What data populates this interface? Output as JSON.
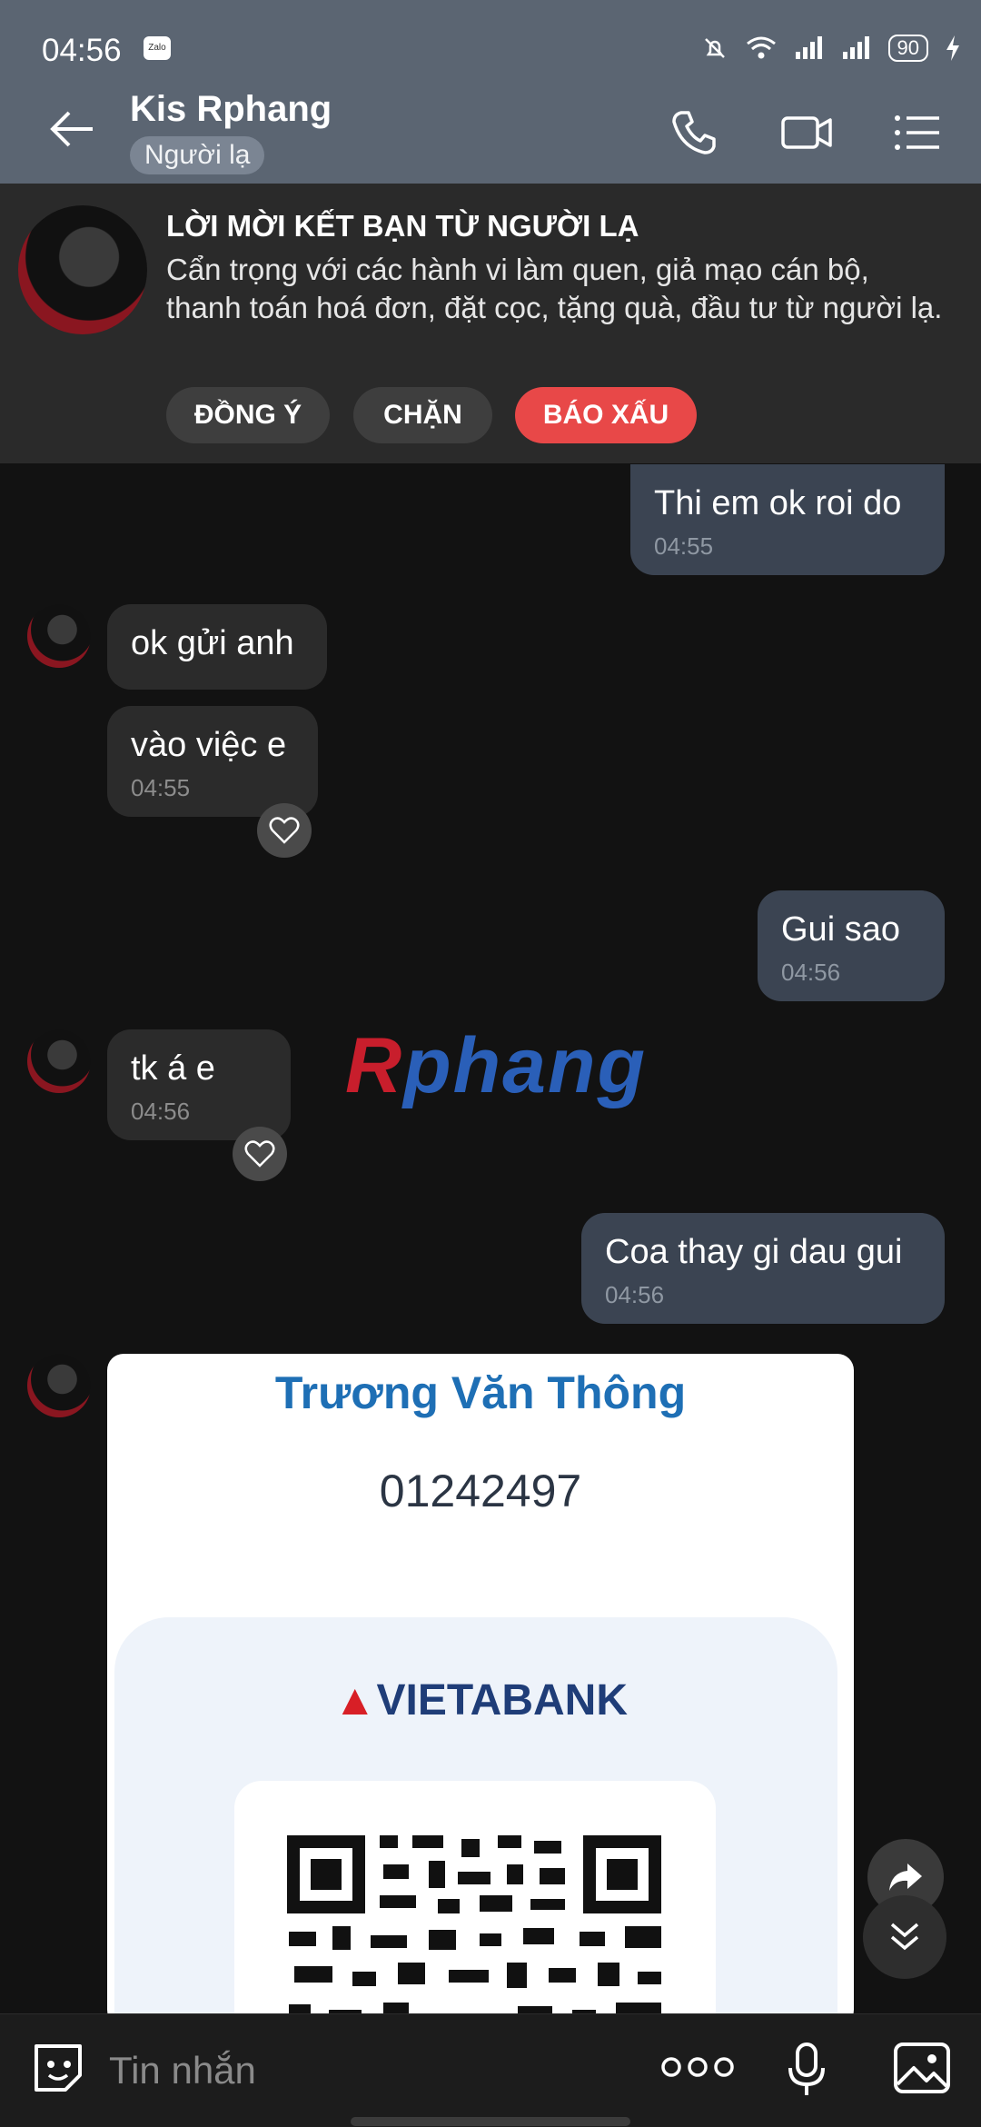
{
  "status_bar": {
    "time": "04:56",
    "zalo_badge": "Zalo",
    "battery": "90"
  },
  "header": {
    "contact_name": "Kis Rphang",
    "badge": "Người lạ"
  },
  "banner": {
    "title": "LỜI MỜI KẾT BẠN TỪ NGƯỜI LẠ",
    "description": "Cẩn trọng với các hành vi làm quen, giả mạo cán bộ, thanh toán hoá đơn, đặt cọc, tặng quà, đầu tư từ người lạ.",
    "accept_label": "ĐỒNG Ý",
    "block_label": "CHẶN",
    "report_label": "BÁO XẤU",
    "report_color": "#e84848"
  },
  "messages": [
    {
      "direction": "out",
      "text": "Thi em ok roi do",
      "time": "04:55"
    },
    {
      "direction": "in",
      "text": "ok gửi anh",
      "time": ""
    },
    {
      "direction": "in",
      "text": "vào việc e",
      "time": "04:55"
    },
    {
      "direction": "out",
      "text": "Gui sao",
      "time": "04:56"
    },
    {
      "direction": "in",
      "text": "tk á e",
      "time": "04:56"
    },
    {
      "direction": "out",
      "text": "Coa thay gi dau gui",
      "time": "04:56"
    }
  ],
  "watermark": {
    "first": "R",
    "rest": "phang"
  },
  "image_card": {
    "account_name": "Trương Văn Thông",
    "account_number": "01242497",
    "bank_name": "VIETABANK"
  },
  "input": {
    "placeholder": "Tin nhắn"
  },
  "icons": {
    "back": "back-arrow-icon",
    "call": "phone-icon",
    "video": "video-call-icon",
    "menu": "list-menu-icon",
    "sticker": "sticker-icon",
    "more": "more-dots-icon",
    "mic": "microphone-icon",
    "gallery": "image-icon",
    "share": "forward-share-icon",
    "scroll": "scroll-down-icon",
    "heart": "heart-icon"
  }
}
